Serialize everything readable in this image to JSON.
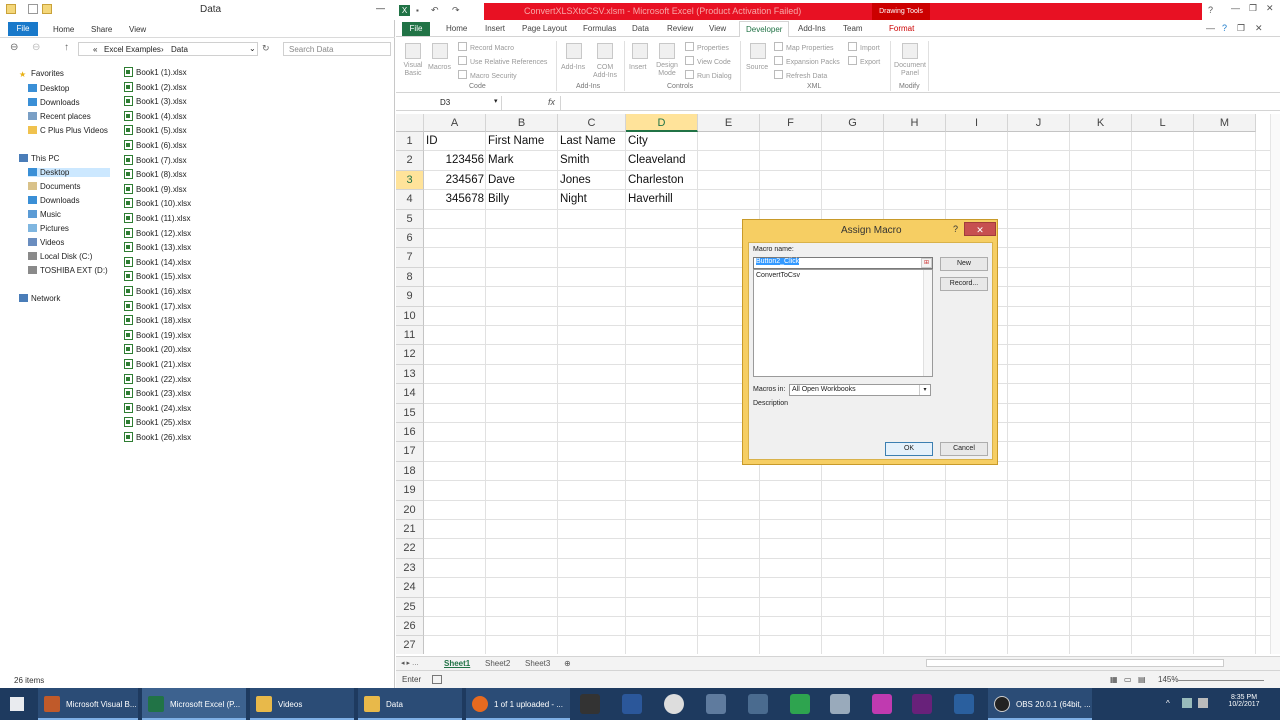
{
  "explorer": {
    "title": "Data",
    "ribbon_tabs": [
      "File",
      "Home",
      "Share",
      "View"
    ],
    "breadcrumb": [
      "«",
      "Excel Examples",
      "›",
      "Data"
    ],
    "search_placeholder": "Search Data",
    "nav": {
      "favorites": "Favorites",
      "fav_items": [
        "Desktop",
        "Downloads",
        "Recent places",
        "C Plus Plus Videos"
      ],
      "this_pc": "This PC",
      "pc_items": [
        "Desktop",
        "Documents",
        "Downloads",
        "Music",
        "Pictures",
        "Videos",
        "Local Disk (C:)",
        "TOSHIBA EXT (D:)"
      ],
      "network": "Network"
    },
    "files": [
      "Book1 (1).xlsx",
      "Book1 (2).xlsx",
      "Book1 (3).xlsx",
      "Book1 (4).xlsx",
      "Book1 (5).xlsx",
      "Book1 (6).xlsx",
      "Book1 (7).xlsx",
      "Book1 (8).xlsx",
      "Book1 (9).xlsx",
      "Book1 (10).xlsx",
      "Book1 (11).xlsx",
      "Book1 (12).xlsx",
      "Book1 (13).xlsx",
      "Book1 (14).xlsx",
      "Book1 (15).xlsx",
      "Book1 (16).xlsx",
      "Book1 (17).xlsx",
      "Book1 (18).xlsx",
      "Book1 (19).xlsx",
      "Book1 (20).xlsx",
      "Book1 (21).xlsx",
      "Book1 (22).xlsx",
      "Book1 (23).xlsx",
      "Book1 (24).xlsx",
      "Book1 (25).xlsx",
      "Book1 (26).xlsx"
    ],
    "status": "26 items"
  },
  "excel": {
    "title": "ConvertXLSXtoCSV.xlsm - Microsoft Excel (Product Activation Failed)",
    "drawing_tools": "Drawing Tools",
    "tabs": [
      "File",
      "Home",
      "Insert",
      "Page Layout",
      "Formulas",
      "Data",
      "Review",
      "View",
      "Developer",
      "Add-Ins",
      "Team",
      "Format"
    ],
    "ribbon": {
      "code": {
        "visual_basic": "Visual Basic",
        "macros": "Macros",
        "record": "Record Macro",
        "relative": "Use Relative References",
        "security": "Macro Security",
        "label": "Code"
      },
      "addins": {
        "addins": "Add-Ins",
        "com": "COM Add-Ins",
        "label": "Add-Ins"
      },
      "controls": {
        "insert": "Insert",
        "design": "Design Mode",
        "properties": "Properties",
        "view_code": "View Code",
        "run_dialog": "Run Dialog",
        "label": "Controls"
      },
      "xml": {
        "source": "Source",
        "map": "Map Properties",
        "packs": "Expansion Packs",
        "refresh": "Refresh Data",
        "import": "Import",
        "export": "Export",
        "label": "XML"
      },
      "modify": {
        "panel": "Document Panel",
        "label": "Modify"
      }
    },
    "name_box": "D3",
    "fx": "fx",
    "columns": [
      "A",
      "B",
      "C",
      "D",
      "E",
      "F",
      "G",
      "H",
      "I",
      "J",
      "K",
      "L",
      "M"
    ],
    "selected_column": "D",
    "selected_row": 3,
    "rows": 27,
    "cells": [
      [
        "ID",
        "First Name",
        "Last Name",
        "City"
      ],
      [
        "123456",
        "Mark",
        "Smith",
        "Cleaveland"
      ],
      [
        "234567",
        "Dave",
        "Jones",
        "Charleston"
      ],
      [
        "345678",
        "Billy",
        "Night",
        "Haverhill"
      ]
    ],
    "sheets": [
      "Sheet1",
      "Sheet2",
      "Sheet3"
    ],
    "status_mode": "Enter",
    "zoom": "145%"
  },
  "dialog": {
    "title": "Assign Macro",
    "help": "?",
    "close": "✕",
    "macro_name_label": "Macro name:",
    "macro_name_value": "Button2_Click",
    "list_items": [
      "ConvertToCsv"
    ],
    "new_btn": "New",
    "record_btn": "Record...",
    "macros_in_label": "Macros in:",
    "macros_in_value": "All Open Workbooks",
    "description_label": "Description",
    "ok_btn": "OK",
    "cancel_btn": "Cancel"
  },
  "taskbar": {
    "apps": [
      "Microsoft Visual B...",
      "Microsoft Excel (P...",
      "Videos",
      "Data",
      "1 of 1 uploaded - ...",
      "OBS 20.0.1 (64bit, ..."
    ],
    "time": "8:35 PM",
    "date": "10/2/2017"
  }
}
